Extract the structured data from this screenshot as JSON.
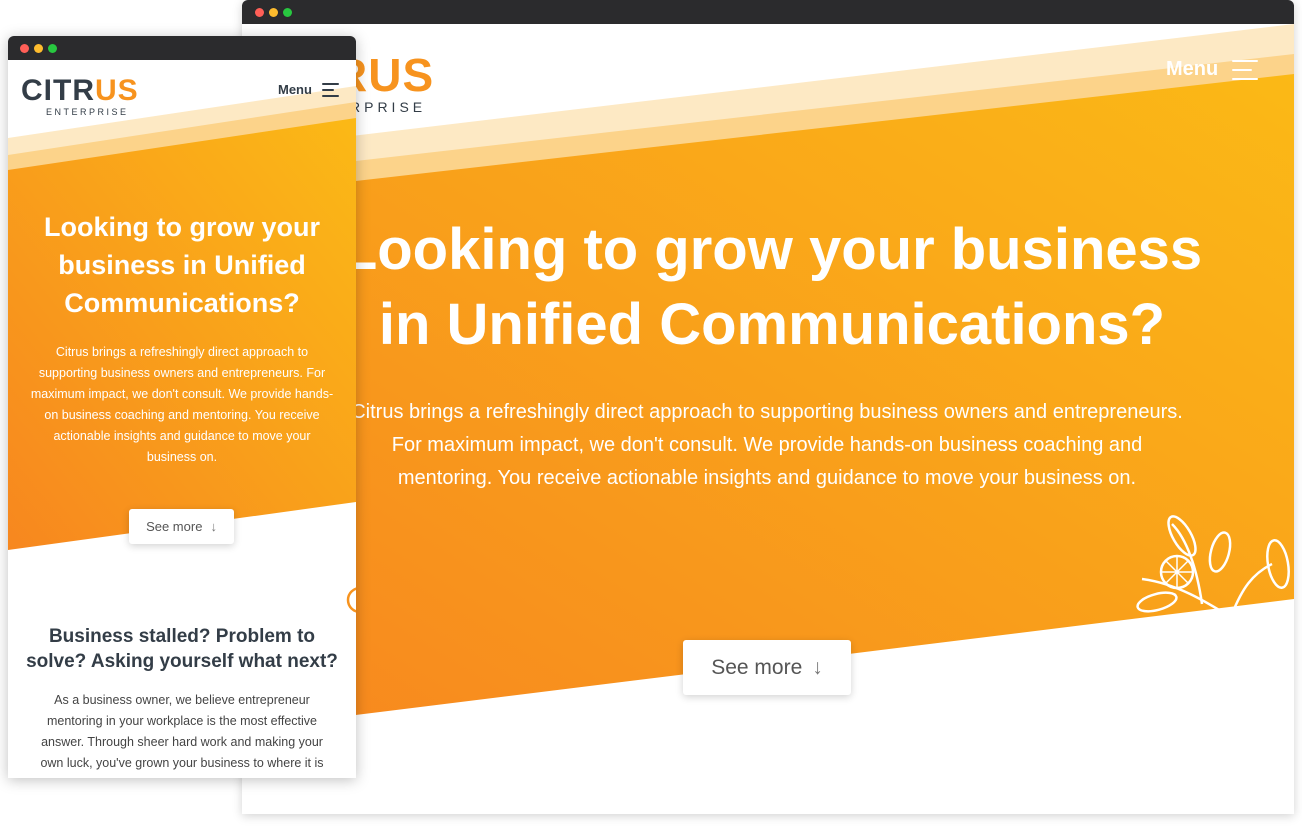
{
  "brand": {
    "logo_prefix": "CITR",
    "logo_suffix": "US",
    "logo_sub": "ENTERPRISE",
    "desktop_logo_visible": "RUS",
    "desktop_sub_visible": "RPRISE",
    "primary_color": "#f7931e",
    "accent_color": "#fbb917",
    "dark_color": "#333d47"
  },
  "nav": {
    "menu_label": "Menu",
    "menu_icon": "hamburger-icon"
  },
  "hero": {
    "title": "Looking to grow your business in Unified Communications?",
    "body": "Citrus brings a refreshingly direct approach to supporting business owners and entrepreneurs. For maximum impact, we don't consult. We provide hands-on business coaching and mentoring. You receive actionable insights and guidance to move your business on.",
    "desktop_title": "Looking to grow your business in Unified Communications?",
    "desktop_body": "Citrus brings a refreshingly direct approach to supporting business owners and entrepreneurs. For maximum impact, we don't consult. We provide hands-on business coaching and mentoring. You receive actionable insights and guidance to move your business on.",
    "cta_label": "See more",
    "cta_icon": "arrow-down-icon"
  },
  "section": {
    "title": "Business stalled? Problem to solve? Asking yourself what next?",
    "body": "As a business owner, we believe entrepreneur mentoring in your workplace is the most effective answer. Through sheer hard work and making your own luck, you've grown your business to where it is today. You won't be alone in thinking what next?"
  }
}
